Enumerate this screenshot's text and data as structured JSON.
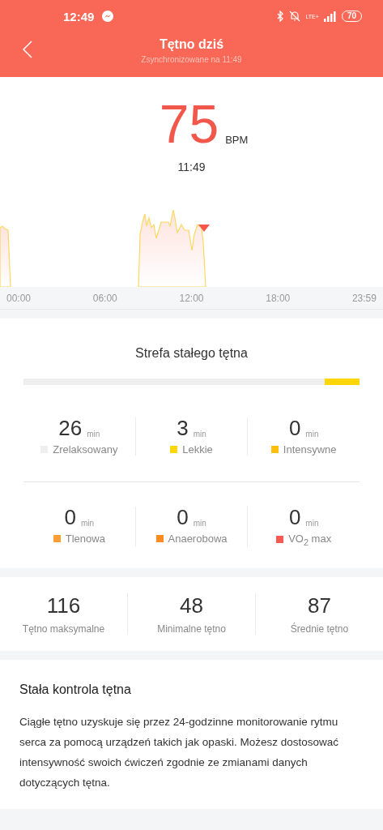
{
  "status_bar": {
    "time": "12:49",
    "network": "LTE+",
    "battery": "70"
  },
  "header": {
    "title": "Tętno dziś",
    "subtitle": "Zsynchronizowane na 11:49"
  },
  "current": {
    "value": "75",
    "unit": "BPM",
    "time": "11:49"
  },
  "chart": {
    "axis_labels": [
      "00:00",
      "06:00",
      "12:00",
      "18:00",
      "23:59"
    ]
  },
  "zones": {
    "title": "Strefa stałego tętna",
    "items": [
      {
        "value": "26",
        "unit": "min",
        "label": "Zrelaksowany",
        "color": "#eeeeee",
        "level": 0.897
      },
      {
        "value": "3",
        "unit": "min",
        "label": "Lekkie",
        "color": "#ffd60a",
        "level": 0.103
      },
      {
        "value": "0",
        "unit": "min",
        "label": "Intensywne",
        "color": "#ffbf0f"
      },
      {
        "value": "0",
        "unit": "min",
        "label": "Tlenowa",
        "color": "#ff9f33"
      },
      {
        "value": "0",
        "unit": "min",
        "label": "Anaerobowa",
        "color": "#ff8a1f"
      },
      {
        "value": "0",
        "unit": "min",
        "label": "VO$_{2}$ max",
        "color": "#f75a52"
      }
    ]
  },
  "stats": [
    {
      "value": "116",
      "label": "Tętno maksymalne"
    },
    {
      "value": "48",
      "label": "Minimalne tętno"
    },
    {
      "value": "87",
      "label": "Średnie tętno"
    }
  ],
  "info": {
    "title": "Stała kontrola tętna",
    "text": "Ciągłe tętno uzyskuje się przez 24-godzinne monitorowanie rytmu serca za pomocą urządzeń takich jak opaski. Możesz dostosować intensywność swoich ćwiczeń zgodnie ze zmianami danych dotyczących tętna."
  }
}
